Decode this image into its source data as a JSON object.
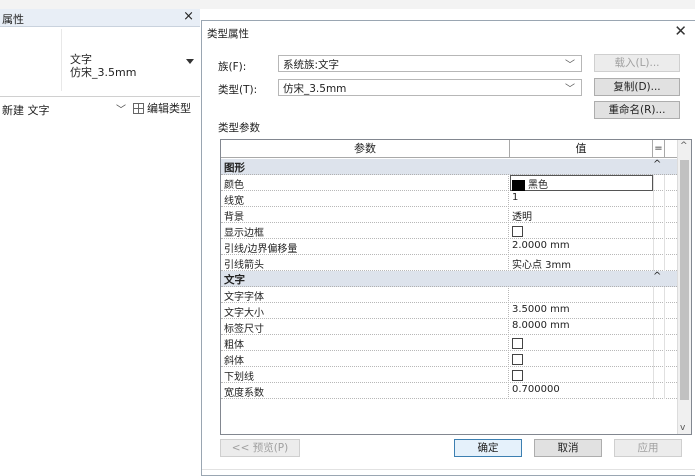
{
  "properties_palette": {
    "title": "属性",
    "close_glyph": "×",
    "type_name_line1": "文字",
    "type_name_line2": "仿宋_3.5mm",
    "instance_filter": "新建 文字",
    "edit_type_label": "编辑类型"
  },
  "dialog": {
    "title": "类型属性",
    "close_glyph": "✕",
    "family_label": "族(F):",
    "family_value": "系统族:文字",
    "type_label": "类型(T):",
    "type_value": "仿宋_3.5mm",
    "load_button": "载入(L)...",
    "duplicate_button": "复制(D)...",
    "rename_button": "重命名(R)...",
    "type_params_label": "类型参数",
    "col_param": "参数",
    "col_value": "值",
    "col_eq": "=",
    "groups": [
      {
        "name": "图形",
        "collapse_glyph": "^",
        "rows": [
          {
            "param": "颜色",
            "value": "黑色"
          },
          {
            "param": "线宽",
            "value": "1"
          },
          {
            "param": "背景",
            "value": "透明"
          },
          {
            "param": "显示边框",
            "value": ""
          },
          {
            "param": "引线/边界偏移量",
            "value": "2.0000 mm"
          },
          {
            "param": "引线箭头",
            "value": "实心点 3mm"
          }
        ]
      },
      {
        "name": "文字",
        "collapse_glyph": "^",
        "rows": [
          {
            "param": "文字字体",
            "value": ""
          },
          {
            "param": "文字大小",
            "value": "3.5000 mm"
          },
          {
            "param": "标签尺寸",
            "value": "8.0000 mm"
          },
          {
            "param": "粗体",
            "value": ""
          },
          {
            "param": "斜体",
            "value": ""
          },
          {
            "param": "下划线",
            "value": ""
          },
          {
            "param": "宽度系数",
            "value": "0.700000"
          }
        ]
      }
    ],
    "preview_button": "<< 预览(P)",
    "ok_button": "确定",
    "cancel_button": "取消",
    "apply_button": "应用"
  },
  "colors": {
    "group_header_bg": "#dde3ec",
    "title_bar_bg": "#e8eef6"
  }
}
